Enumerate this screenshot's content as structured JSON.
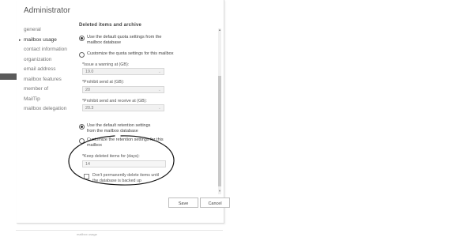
{
  "window": {
    "title": "Administrator"
  },
  "nav": {
    "items": [
      {
        "id": "general",
        "label": "general",
        "active": false
      },
      {
        "id": "mailbox-usage",
        "label": "mailbox usage",
        "active": true
      },
      {
        "id": "contact-information",
        "label": "contact information",
        "active": false
      },
      {
        "id": "organization",
        "label": "organization",
        "active": false
      },
      {
        "id": "email-address",
        "label": "email address",
        "active": false
      },
      {
        "id": "mailbox-features",
        "label": "mailbox features",
        "active": false
      },
      {
        "id": "member-of",
        "label": "member of",
        "active": false
      },
      {
        "id": "mailtip",
        "label": "MailTip",
        "active": false
      },
      {
        "id": "mailbox-delegation",
        "label": "mailbox delegation",
        "active": false
      }
    ],
    "active_indicator": "▸"
  },
  "content": {
    "clipped_heading": "Deleted items and archive",
    "quota": {
      "default_option": "Use the default quota settings from the mailbox database",
      "custom_option": "Customize the quota settings for this mailbox",
      "default_selected": true,
      "issue_warning_label": "*Issue a warning at (GB):",
      "issue_warning_value": "19.0",
      "prohibit_send_label": "*Prohibit send at (GB):",
      "prohibit_send_value": "20",
      "prohibit_send_receive_label": "*Prohibit send and receive at (GB):",
      "prohibit_send_receive_value": "20.3"
    },
    "retention": {
      "default_option": "Use the default retention settings from the mailbox database",
      "custom_option": "Customize the retention settings for this mailbox",
      "default_selected": true,
      "keep_deleted_label": "*Keep deleted items for (days):",
      "keep_deleted_value": "14",
      "dont_delete_label": "Don't permanently delete items until the database is backed up",
      "dont_delete_checked": false
    }
  },
  "buttons": {
    "save": "Save",
    "cancel": "Cancel"
  },
  "icons": {
    "dropdown": "chevron-down-icon",
    "scroll_up": "arrow-up-icon",
    "scroll_down": "arrow-down-icon"
  },
  "footer": {
    "clipped_text": "mailbox usage"
  },
  "colors": {
    "annotation": "#111111"
  }
}
